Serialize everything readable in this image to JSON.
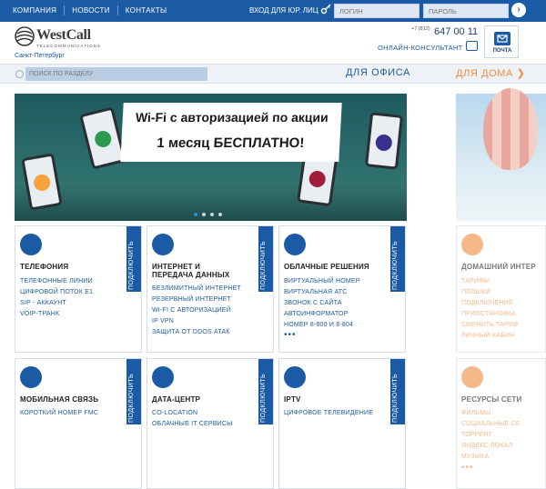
{
  "topbar": {
    "nav": [
      "КОМПАНИЯ",
      "НОВОСТИ",
      "КОНТАКТЫ"
    ],
    "login_label": "ВХОД ДЛЯ ЮР. ЛИЦ",
    "login_placeholder": "ЛОГИН",
    "password_placeholder": "ПАРОЛЬ"
  },
  "header": {
    "logo_word": "WestCall",
    "logo_sub": "TELECOMMUNICATIONS",
    "city": "Санкт-Петербург",
    "phone_code": "+7 (812)",
    "phone": "647 00 11",
    "consultant": "ОНЛАЙН-КОНСУЛЬТАНТ",
    "mail_label": "ПОЧТА"
  },
  "search": {
    "placeholder": "ПОИСК ПО РАЗДЕЛУ"
  },
  "segments": {
    "office": "ДЛЯ ОФИСА",
    "home": "ДЛЯ ДОМА ❯"
  },
  "banner": {
    "line1": "Wi-Fi с авторизацией по акции",
    "line2": "1 месяц БЕСПЛАТНО!",
    "slide_count": 4,
    "active_slide": 1
  },
  "connect_label": "ПОДКЛЮЧИТЬ",
  "cards": [
    {
      "title": "ТЕЛЕФОНИЯ",
      "links": [
        "ТЕЛЕФОННЫЕ ЛИНИИ",
        "ЦИФРОВОЙ ПОТОК Е1",
        "SIP - АККАУНТ",
        "VOIP-ТРАНК"
      ],
      "more": ""
    },
    {
      "title": "ИНТЕРНЕТ И\nПЕРЕДАЧА ДАННЫХ",
      "links": [
        "БЕЗЛИМИТНЫЙ ИНТЕРНЕТ",
        "РЕЗЕРВНЫЙ ИНТЕРНЕТ",
        "WI-FI С АВТОРИЗАЦИЕЙ",
        "IP VPN",
        "ЗАЩИТА ОТ DDOS АТАК"
      ],
      "more": ""
    },
    {
      "title": "ОБЛАЧНЫЕ РЕШЕНИЯ",
      "links": [
        "ВИРТУАЛЬНЫЙ НОМЕР",
        "ВИРТУАЛЬНАЯ АТС",
        "ЗВОНОК С САЙТА",
        "АВТОИНФОРМАТОР",
        "НОМЕР 8-800 И 8-804"
      ],
      "more": "•••"
    },
    {
      "title": "ДОМАШНИЙ ИНТЕР",
      "links": [
        "ТАРИФЫ",
        "ПЛОШКИ",
        "ПОДКЛЮЧЕНИЕ",
        "ПРИОСТАНОВКА",
        "СМЕНИТЬ ТАРИФ",
        "ЛИЧНЫЙ КАБИН"
      ],
      "more": ""
    },
    {
      "title": "МОБИЛЬНАЯ СВЯЗЬ",
      "links": [
        "КОРОТКИЙ НОМЕР FMC"
      ],
      "more": ""
    },
    {
      "title": "ДАТА-ЦЕНТР",
      "links": [
        "CO-LOCATION",
        "ОБЛАЧНЫЕ IT СЕРВИСЫ"
      ],
      "more": ""
    },
    {
      "title": "IPTV",
      "links": [
        "ЦИФРОВОЕ ТЕЛЕВИДЕНИЕ"
      ],
      "more": ""
    },
    {
      "title": "РЕСУРСЫ СЕТИ",
      "links": [
        "ФИЛЬМЫ",
        "СОЦИАЛЬНЫЕ СЕ",
        "ТОРРЕНТ",
        "ЯНДЕКС ЛОКАЛ",
        "МУЗЫКА"
      ],
      "more": "•••"
    }
  ]
}
